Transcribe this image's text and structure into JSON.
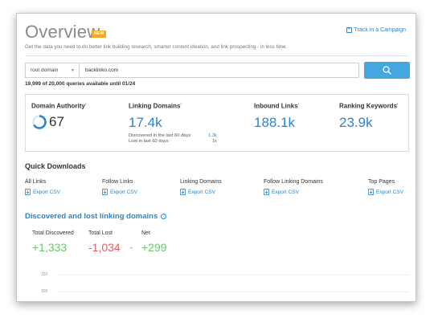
{
  "header": {
    "title": "Overview",
    "badge": "NEW",
    "track_link": "Track in a Campaign",
    "subtitle": "Get the data you need to do better link building research, smarter content ideation, and link prospecting - in less time."
  },
  "search": {
    "scope": "root domain",
    "value": "backlinko.com",
    "queries_text": "19,999 of 20,000 queries available until 01/24"
  },
  "metrics": {
    "domain_authority": {
      "label": "Domain Authority",
      "value": "67",
      "score": 67
    },
    "linking_domains": {
      "label": "Linking Domains",
      "value": "17.4k",
      "discovered_label": "Discovered in the last 60 days",
      "discovered_value": "1.3k",
      "lost_label": "Lost in last 60 days",
      "lost_value": "1k"
    },
    "inbound_links": {
      "label": "Inbound Links",
      "value": "188.1k"
    },
    "ranking_keywords": {
      "label": "Ranking Keywords",
      "value": "23.9k"
    }
  },
  "quick_downloads": {
    "title": "Quick Downloads",
    "items": [
      {
        "label": "All Links",
        "action": "Export CSV"
      },
      {
        "label": "Follow Links",
        "action": "Export CSV"
      },
      {
        "label": "Linking Domains",
        "action": "Export CSV"
      },
      {
        "label": "Follow Linking Domains",
        "action": "Export CSV"
      },
      {
        "label": "Top Pages",
        "action": "Export CSV"
      }
    ]
  },
  "discovered": {
    "title": "Discovered and lost linking domains",
    "total_discovered_label": "Total Discovered",
    "total_discovered": "+1,333",
    "total_lost_label": "Total Lost",
    "total_lost": "-1,034",
    "separator": "-",
    "net_label": "Net",
    "net": "+299"
  },
  "chart_data": {
    "type": "bar",
    "y_ticks": [
      "150",
      "100"
    ],
    "categories": [],
    "values": []
  },
  "colors": {
    "accent": "#2a85c9",
    "button": "#45a7e0",
    "badge": "#f5a623",
    "positive": "#6cc36c",
    "negative": "#e35d5d"
  }
}
